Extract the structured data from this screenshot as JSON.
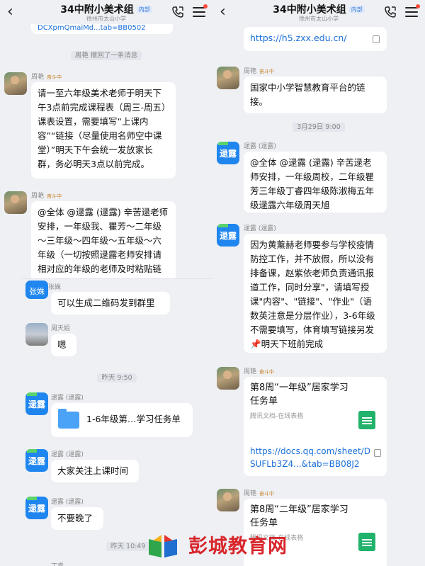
{
  "header": {
    "title": "34中附小美术组",
    "tag": "内部",
    "subtitle": "徐州市太山小学"
  },
  "left": {
    "cut_link": "DCXpmQmaiMd...tab=BB0502",
    "recall_notice": "周艳 撤回了一条消息",
    "msg1": {
      "sender": "周艳",
      "badge": "奋斗中",
      "text": "请一至六年级美术老师于明天下午3点前完成课程表（周三-周五）课表设置，需要填写“上课内容”“链接（尽量使用名师空中课堂）”明天下午会统一发放家长群，务必明天3点以前完成。"
    },
    "msg2": {
      "sender": "周艳",
      "badge": "奋斗中",
      "text": "@全体 @逯露 (逯露) 辛苦逯老师安排，一年级我、瞿芳～二年级～三年级～四年级～五年级～六年级（一切按照逯露老师安排请相对应的年级的老师及时粘贴链接）🕯️🎂🍰明天我在学校值班，下午有事情及时和我联系"
    }
  },
  "inset": {
    "cut_name": "张姝",
    "msg_zhangshu": {
      "avatar": "张姝",
      "text": "可以生成二维码发到群里"
    },
    "msg_zhoutianju": {
      "sender": "周天姐",
      "text": "嗯"
    },
    "time1": "昨天 9:50",
    "file_msg": {
      "sender": "逯露 (逯露)",
      "avatar": "逯露",
      "file": "1-6年级第…学习任务单"
    },
    "msg_attention": {
      "sender": "逯露 (逯露)",
      "avatar": "逯露",
      "text": "大家关注上课时间"
    },
    "msg_late": {
      "sender": "逯露 (逯露)",
      "avatar": "逯露",
      "text": "不要晚了"
    },
    "time2": "昨天 10:49",
    "cut_sender": "丁睿"
  },
  "right": {
    "link1": "https://h5.zxx.edu.cn/",
    "msg_platform": {
      "sender": "周艳",
      "badge": "奋斗中",
      "text": "国家中小学智慧教育平台的链接。"
    },
    "date1": "3月29日 9:00",
    "msg_notice": {
      "sender": "逯露 (逯露)",
      "avatar": "逯露",
      "text": "@全体 @逯露 (逯露) 辛苦逯老师安排，一年级周校，二年级瞿芳三年级丁睿四年级陈淑梅五年级逯露六年级周天旭"
    },
    "msg_covid": {
      "sender": "逯露 (逯露)",
      "avatar": "逯露",
      "text": "因为黄薰赫老师要参与学校疫情防控工作，并不放假，所以没有排备课，赵紫依老师负责通讯报道工作，同时分享\"，请填写授课\"内容\"、\"链接\"、\"作业\"（语数英注意是分层作业），3-6年级不需要填写，体育填写链接另发📌明天下班前完成"
    },
    "card1": {
      "sender": "周艳",
      "badge": "奋斗中",
      "title": "第8周“一年级”居家学习任务单",
      "source": "腾讯文档-在线表格",
      "link": "https://docs.qq.com/sheet/DSUFLb3Z4...&tab=BB08J2"
    },
    "card2": {
      "sender": "周艳",
      "badge": "奋斗中",
      "title": "第8周“二年级”居家学习任务单",
      "source": "腾讯文档-在线表格"
    }
  },
  "watermark": {
    "text": "彭城教育网"
  }
}
